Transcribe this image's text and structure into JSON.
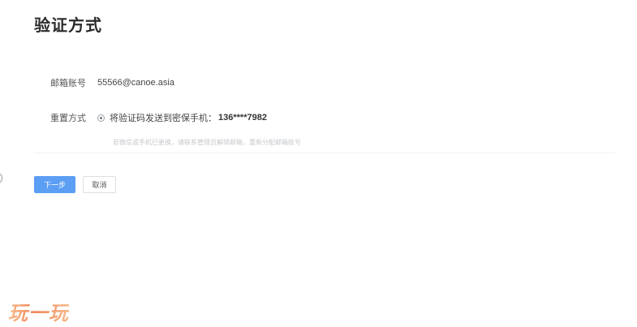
{
  "page": {
    "title": "验证方式"
  },
  "form": {
    "email_label": "邮箱账号",
    "email_value": "55566@canoe.asia",
    "method_label": "重置方式",
    "method_option_text": "将验证码发送到密保手机：",
    "method_option_phone": "136****7982",
    "hint": "若微信或手机已更换，请联系管理员解绑邮箱，重新分配邮箱账号"
  },
  "buttons": {
    "next_label": "下一步",
    "cancel_label": "取消"
  },
  "watermark": {
    "text": "玩一玩"
  },
  "colors": {
    "primary": "#5b9ef4",
    "hint": "#c5c8cc",
    "watermark": "#f08a5d"
  }
}
